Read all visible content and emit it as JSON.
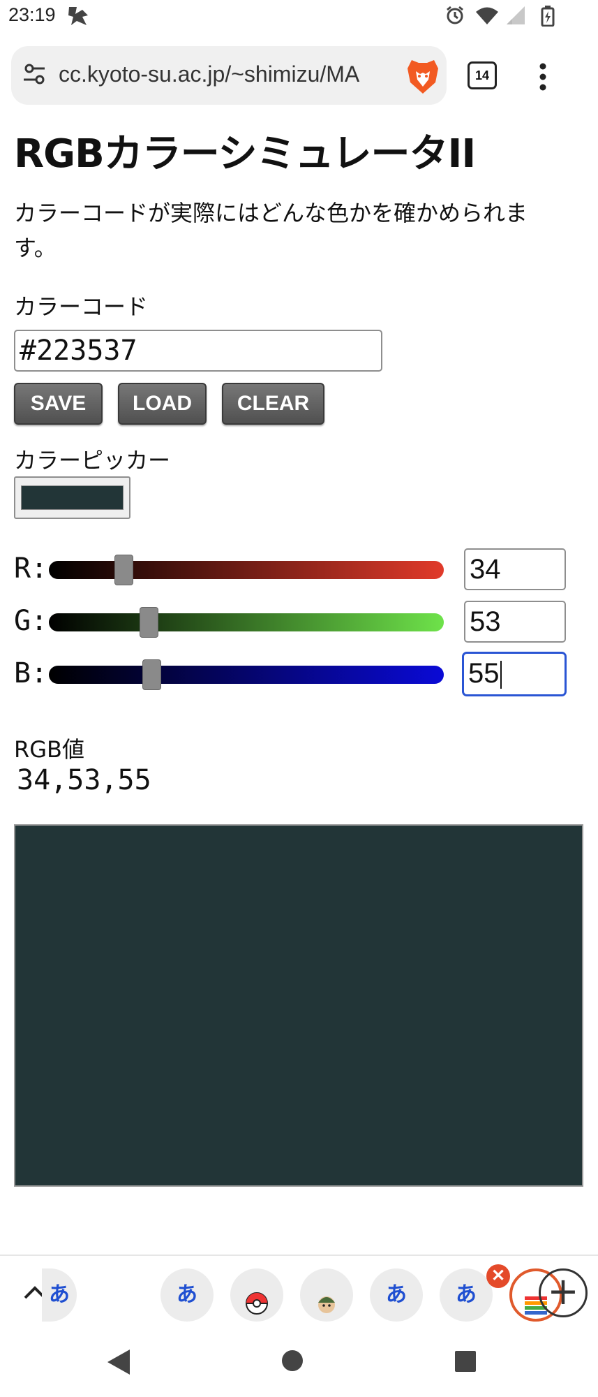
{
  "status_bar": {
    "time": "23:19",
    "icons": [
      "notification-app-icon",
      "alarm-icon",
      "wifi-icon",
      "signal-icon",
      "battery-icon"
    ]
  },
  "browser": {
    "url": "cc.kyoto-su.ac.jp/~shimizu/MA",
    "tab_count": "14",
    "icons": [
      "site-settings-icon",
      "brave-lion-icon",
      "tab-switcher-icon",
      "menu-kebab-icon"
    ]
  },
  "page": {
    "title": "RGBカラーシミュレータII",
    "intro": "カラーコードが実際にはどんな色かを確かめられます。",
    "color_code_label": "カラーコード",
    "color_code_value": "#223537",
    "buttons": {
      "save": "SAVE",
      "load": "LOAD",
      "clear": "CLEAR"
    },
    "picker_label": "カラーピッカー",
    "picker_color": "#223537",
    "sliders": {
      "r": {
        "label": "R:",
        "value": "34",
        "max": 255,
        "gradient_end": "#e13a2a"
      },
      "g": {
        "label": "G:",
        "value": "53",
        "max": 255,
        "gradient_end": "#6ee24a"
      },
      "b": {
        "label": "B:",
        "value": "55",
        "max": 255,
        "gradient_end": "#0a0ad6"
      }
    },
    "rgb_label": "RGB値",
    "rgb_value": "34,53,55",
    "preview_color": "#223537"
  },
  "tab_strip": {
    "tabs": [
      {
        "kind": "hiragana",
        "label": "あ"
      },
      {
        "kind": "hiragana",
        "label": "あ"
      },
      {
        "kind": "icon",
        "icon": "pokeball-icon"
      },
      {
        "kind": "icon",
        "icon": "character-face-icon"
      },
      {
        "kind": "hiragana",
        "label": "あ"
      },
      {
        "kind": "hiragana",
        "label": "あ"
      },
      {
        "kind": "icon",
        "icon": "color-stripes-icon",
        "active": true
      }
    ],
    "close_label": "✕",
    "new_tab_label": "+"
  },
  "colors": {
    "accent_orange": "#e05a2c",
    "focus_blue": "#2a55d4",
    "hiragana_blue": "#1f4fd1"
  }
}
